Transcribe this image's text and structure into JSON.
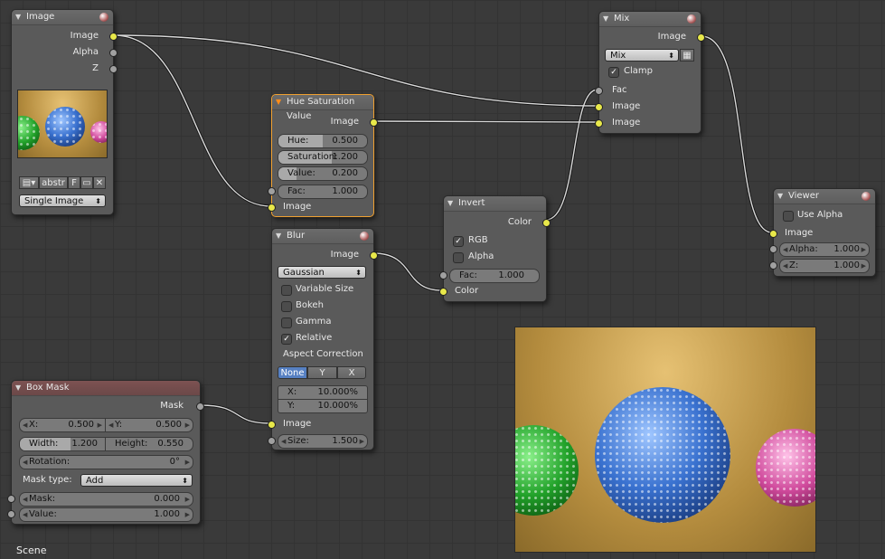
{
  "nodes": {
    "image": {
      "title": "Image",
      "outputs": [
        "Image",
        "Alpha",
        "Z"
      ],
      "buttons": {
        "image_type_icon": "image-browse-icon",
        "name": "abstr",
        "fake_user": "F",
        "open_icon": "folder-icon",
        "unlink_icon": "close-icon"
      },
      "source": "Single Image"
    },
    "hsv": {
      "title": "Hue Saturation Value",
      "output": "Image",
      "fields": [
        {
          "label": "Hue:",
          "value": "0.500",
          "fill": 0.5
        },
        {
          "label": "Saturation:",
          "value": "1.200",
          "fill": 0.6
        },
        {
          "label": "Value:",
          "value": "0.200",
          "fill": 0.2
        },
        {
          "label": "Fac:",
          "value": "1.000",
          "fill": 1.0
        }
      ],
      "input": "Image"
    },
    "mix": {
      "title": "Mix",
      "output": "Image",
      "blend": "Mix",
      "clamp_label": "Clamp",
      "clamp": true,
      "inputs": [
        "Fac",
        "Image",
        "Image"
      ]
    },
    "blur": {
      "title": "Blur",
      "output": "Image",
      "filter": "Gaussian",
      "options": [
        {
          "label": "Variable Size",
          "checked": false
        },
        {
          "label": "Bokeh",
          "checked": false
        },
        {
          "label": "Gamma",
          "checked": false
        },
        {
          "label": "Relative",
          "checked": true
        }
      ],
      "aspect_label": "Aspect Correction",
      "aspect_buttons": [
        "None",
        "Y",
        "X"
      ],
      "aspect_selected": "None",
      "factors": [
        {
          "label": "X:",
          "value": "10.000%"
        },
        {
          "label": "Y:",
          "value": "10.000%"
        }
      ],
      "input": "Image",
      "size": {
        "label": "Size:",
        "value": "1.500"
      }
    },
    "invert": {
      "title": "Invert",
      "output": "Color",
      "options": [
        {
          "label": "RGB",
          "checked": true
        },
        {
          "label": "Alpha",
          "checked": false
        }
      ],
      "fac": {
        "label": "Fac:",
        "value": "1.000"
      },
      "input": "Color"
    },
    "viewer": {
      "title": "Viewer",
      "use_alpha_label": "Use Alpha",
      "use_alpha": false,
      "input": "Image",
      "fields": [
        {
          "label": "Alpha:",
          "value": "1.000"
        },
        {
          "label": "Z:",
          "value": "1.000"
        }
      ]
    },
    "boxmask": {
      "title": "Box Mask",
      "output": "Mask",
      "x": {
        "label": "X:",
        "value": "0.500"
      },
      "y": {
        "label": "Y:",
        "value": "0.500"
      },
      "width": {
        "label": "Width:",
        "value": "1.200",
        "fill": 0.6
      },
      "height": {
        "label": "Height:",
        "value": "0.550"
      },
      "rotation": {
        "label": "Rotation:",
        "value": "0°"
      },
      "mask_type_label": "Mask type:",
      "mask_type": "Add",
      "inputs": [
        {
          "label": "Mask:",
          "value": "0.000"
        },
        {
          "label": "Value:",
          "value": "1.000"
        }
      ]
    }
  },
  "backdrop_label": "Scene",
  "colors": {
    "socket_image": "#e8e84a",
    "socket_value": "#a0a0a0",
    "active_border": "#f0a030",
    "selected_button": "#5680c2"
  }
}
